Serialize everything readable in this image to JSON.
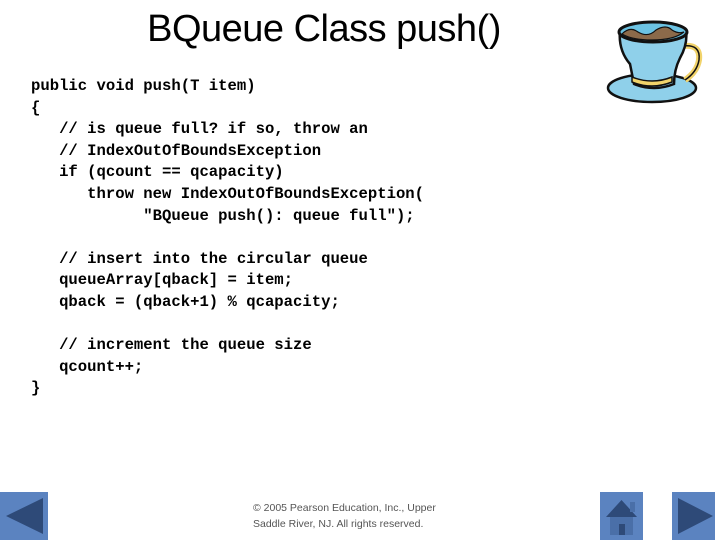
{
  "slide": {
    "title": "BQueue Class push()",
    "code_lines": [
      "public void push(T item)",
      "{",
      "   // is queue full? if so, throw an",
      "   // IndexOutOfBoundsException",
      "   if (qcount == qcapacity)",
      "      throw new IndexOutOfBoundsException(",
      "            \"BQueue push(): queue full\");",
      "",
      "   // insert into the circular queue",
      "   queueArray[qback] = item;",
      "   qback = (qback+1) % qcapacity;",
      "",
      "   // increment the queue size",
      "   qcount++;",
      "}"
    ],
    "illustration": "coffee-cup-icon"
  },
  "footer": {
    "line1": "© 2005 Pearson Education, Inc., Upper",
    "line2": "Saddle River, NJ.  All rights reserved."
  },
  "navigation": {
    "prev": {
      "icon": "previous-arrow-icon"
    },
    "home": {
      "icon": "home-icon"
    },
    "next": {
      "icon": "next-arrow-icon"
    },
    "button_color": "#5b83c0",
    "glyph_color": "#2e4a78"
  }
}
